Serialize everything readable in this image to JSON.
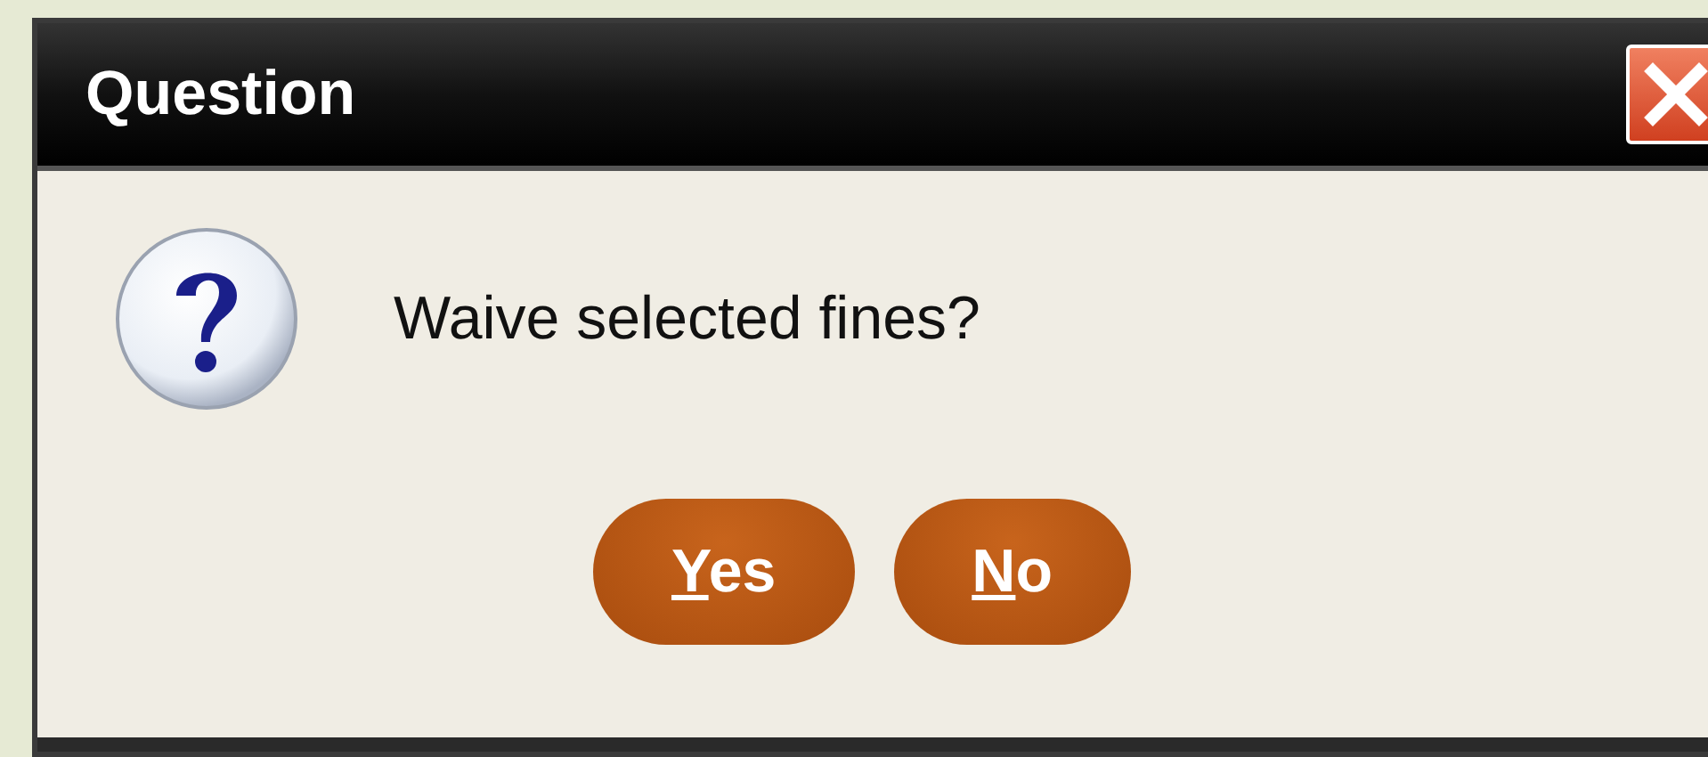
{
  "window": {
    "title": "Question"
  },
  "message": "Waive selected fines?",
  "buttons": [
    {
      "label": "Yes"
    },
    {
      "label": "No"
    }
  ]
}
